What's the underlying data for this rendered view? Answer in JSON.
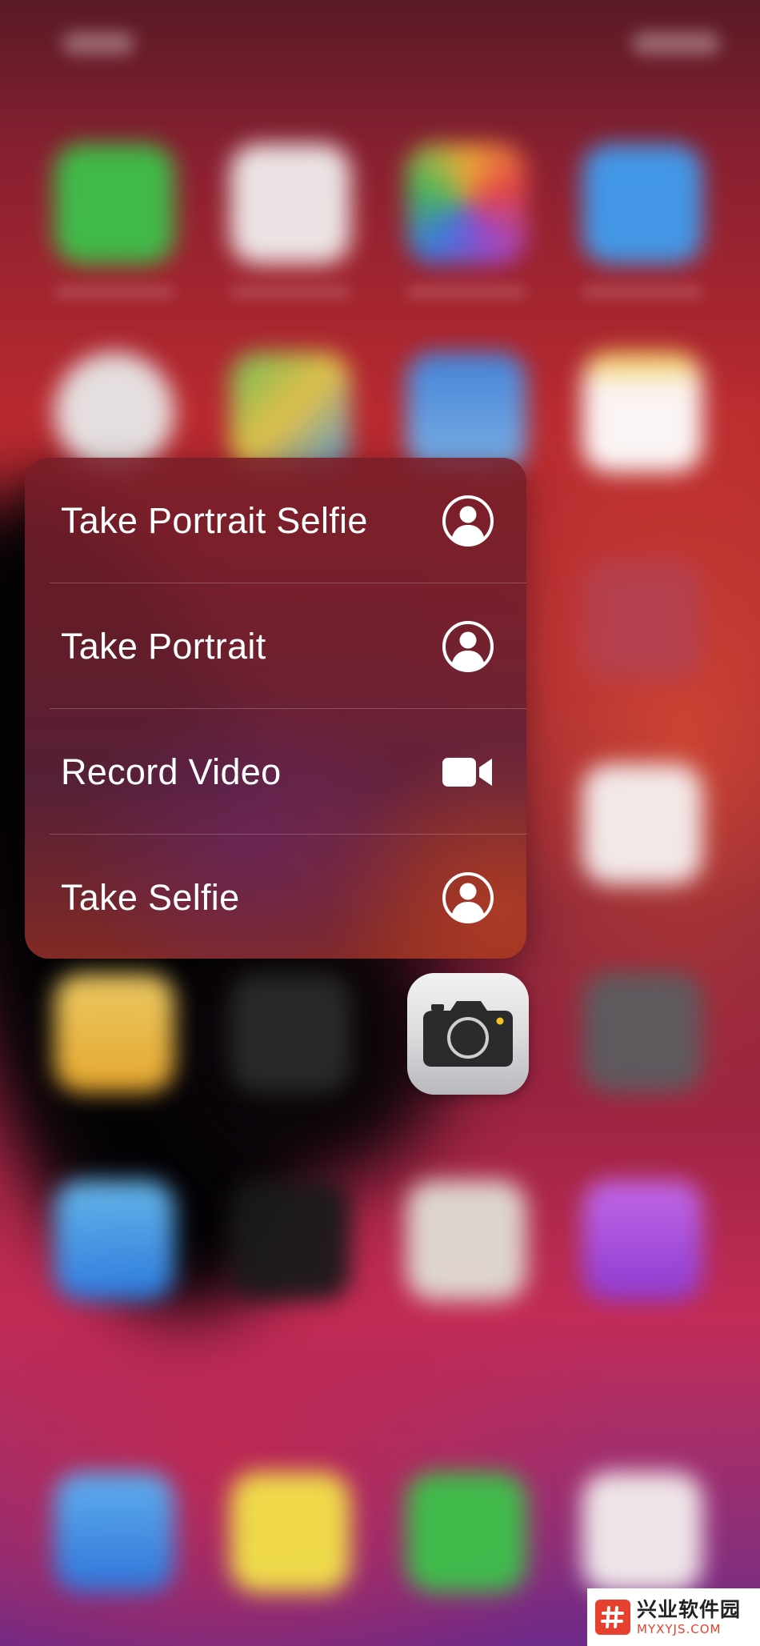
{
  "menu": {
    "items": [
      {
        "label": "Take Portrait Selfie",
        "icon": "person-circle-icon"
      },
      {
        "label": "Take Portrait",
        "icon": "person-circle-icon"
      },
      {
        "label": "Record Video",
        "icon": "video-camera-icon"
      },
      {
        "label": "Take Selfie",
        "icon": "person-circle-icon"
      }
    ]
  },
  "camera_app": {
    "icon": "camera-icon"
  },
  "watermark": {
    "title": "兴业软件园",
    "url": "MYXYJS.COM"
  },
  "colors": {
    "menu_text": "#ffffff",
    "watermark_accent": "#e8402f"
  }
}
